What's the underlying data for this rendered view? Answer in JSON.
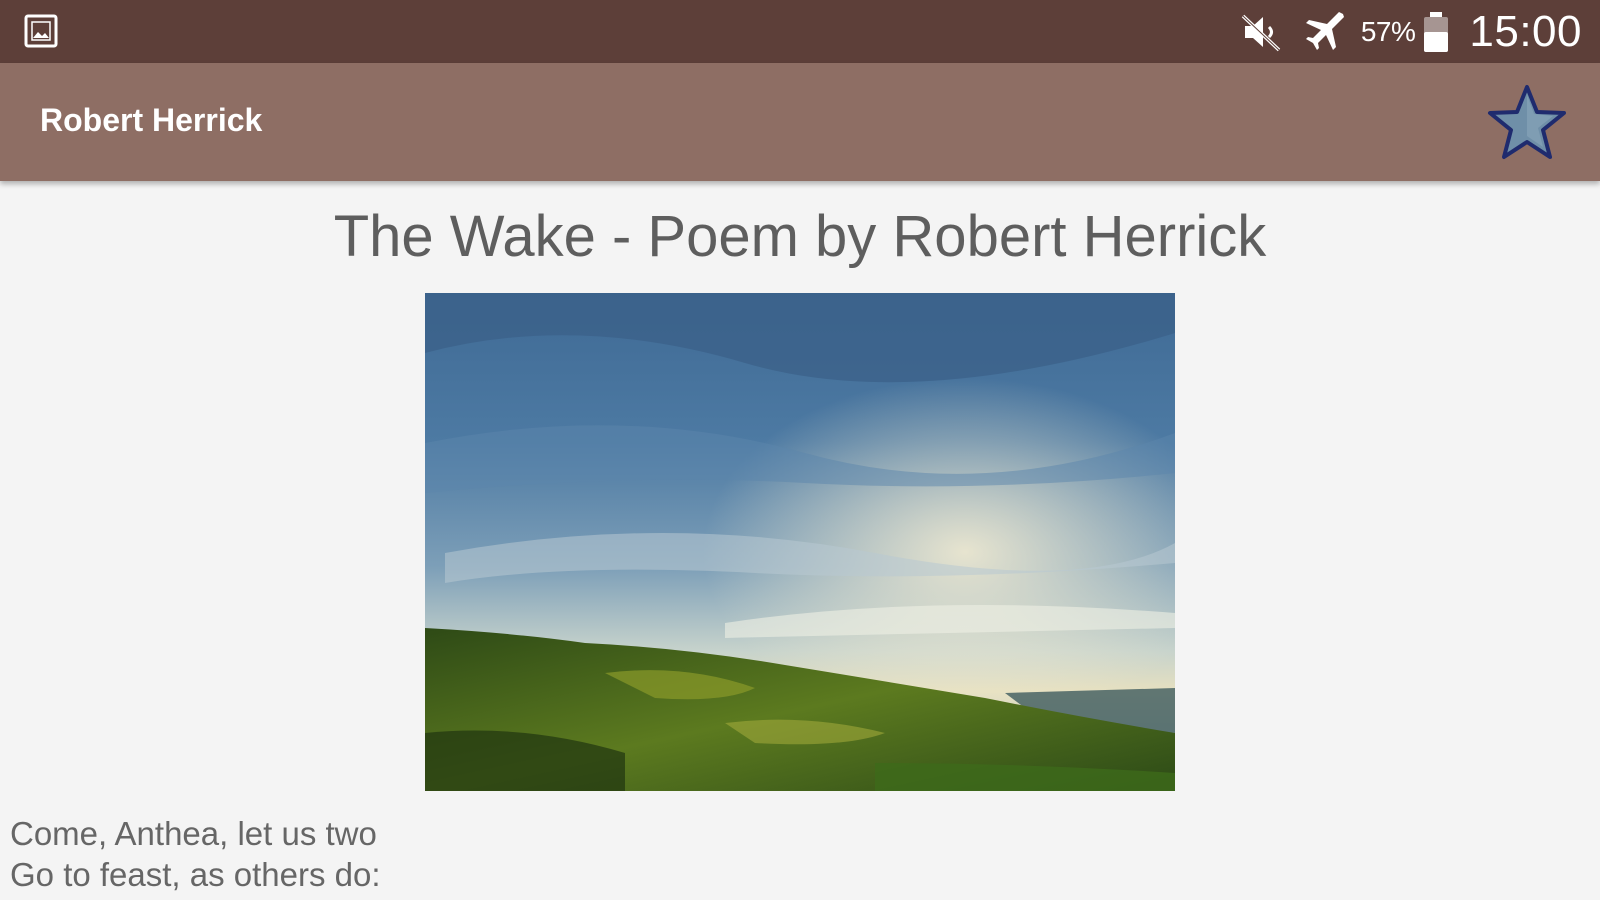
{
  "status_bar": {
    "battery_percent": "57%",
    "battery_level": 0.57,
    "time": "15:00",
    "icons": [
      "gallery-notification-icon",
      "mute-icon",
      "airplane-mode-icon",
      "battery-icon"
    ]
  },
  "app_bar": {
    "title": "Robert Herrick",
    "favorite_icon": "star-icon"
  },
  "poem": {
    "title": "The Wake - Poem by Robert Herrick",
    "image_description_icon": "landscape-image",
    "lines": [
      "Come, Anthea, let us two",
      "Go to feast, as others do:"
    ]
  },
  "colors": {
    "status_bar": "#5d3f39",
    "app_bar": "#8e6e64",
    "background": "#f4f4f4",
    "star_fill": "#6f8fa8",
    "star_outline": "#1f2b6e"
  }
}
